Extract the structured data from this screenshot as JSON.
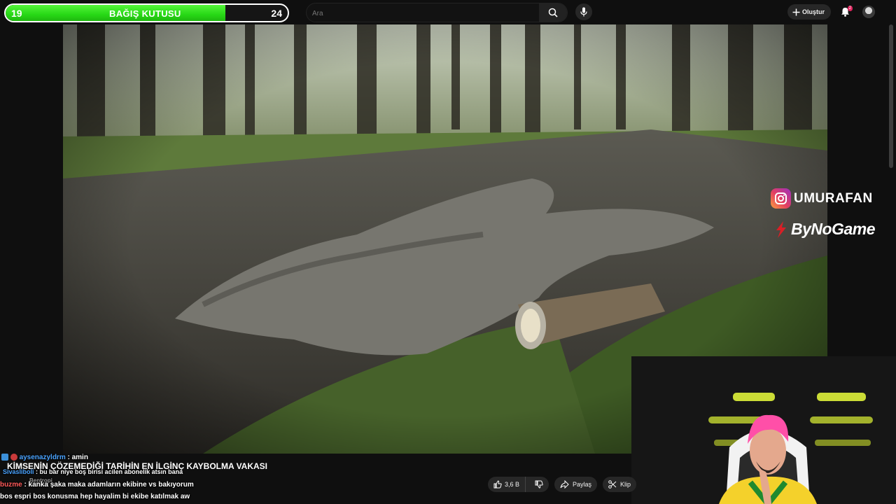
{
  "donation": {
    "title": "BAĞIŞ KUTUSU",
    "current": "19",
    "goal": "24",
    "progress": 0.78
  },
  "search": {
    "placeholder": "Ara",
    "search_icon": "search-icon",
    "mic_icon": "microphone-icon"
  },
  "header": {
    "create_label": "Oluştur",
    "notifications_count": "2"
  },
  "overlay": {
    "instagram_handle": "UMURAFAN",
    "sponsor": "ByNoGame"
  },
  "video": {
    "title": "KİMSENİN ÇÖZEMEDİĞİ TARİHİN EN İLGİNÇ KAYBOLMA VAKASI"
  },
  "actions": {
    "likes": "3,6 B",
    "share": "Paylaş",
    "clip": "Klip"
  },
  "chat": [
    {
      "user": "aysenazyldrm",
      "message": ": amin",
      "color": "#4aa3ff"
    },
    {
      "user": "Sivasliboli",
      "message": ": bu bar niye boş birisi acilen abonelik atsın bana",
      "color": "#4aa3ff"
    },
    {
      "user": "Bentropi",
      "message": "",
      "color": "#9a9a9a"
    },
    {
      "user": "buzme",
      "message": ": kanka şaka maka adamların ekibine vs bakıyorum",
      "color": "#ff5a5a"
    },
    {
      "user": "",
      "message": "bos espri bos konusma hep hayalim bi ekibe katılmak aw",
      "color": "#ffffff"
    }
  ],
  "colors": {
    "donation_fill": "#27d816",
    "accent": "#e0245e"
  }
}
